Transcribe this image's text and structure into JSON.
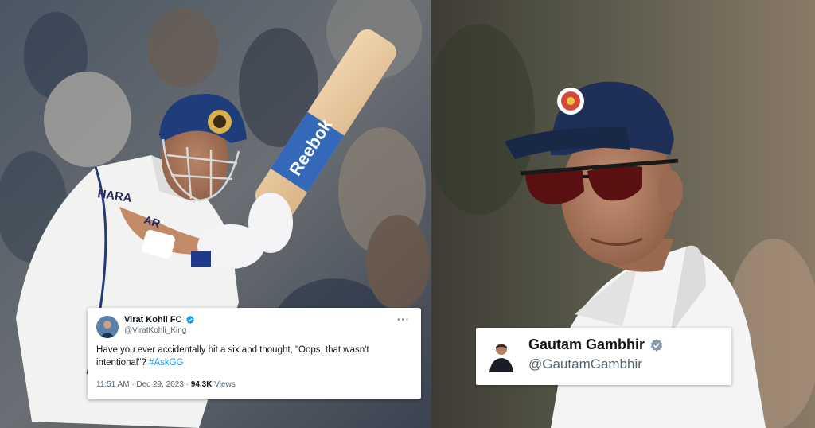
{
  "left_panel": {
    "bat_brand": "Reebok",
    "shirt_sponsor": "HARA",
    "shirt_sponsor2": "AR"
  },
  "tweet": {
    "display_name": "Virat Kohli FC",
    "handle": "@ViratKohli_King",
    "text_main": "Have you ever accidentally hit a six and thought, \"Oops, that wasn't intentional\"? ",
    "hashtag": "#AskGG",
    "time": "11:51 AM · Dec 29, 2023 · ",
    "views_count": "94.3K",
    "views_label": " Views",
    "more_label": "···",
    "verified_color": "#1d9bf0"
  },
  "profile": {
    "display_name": "Gautam Gambhir",
    "handle": "@GautamGambhir",
    "verified_color": "#829aab"
  },
  "icons": {
    "verified": "verified-badge-icon",
    "more": "more-options-icon"
  }
}
